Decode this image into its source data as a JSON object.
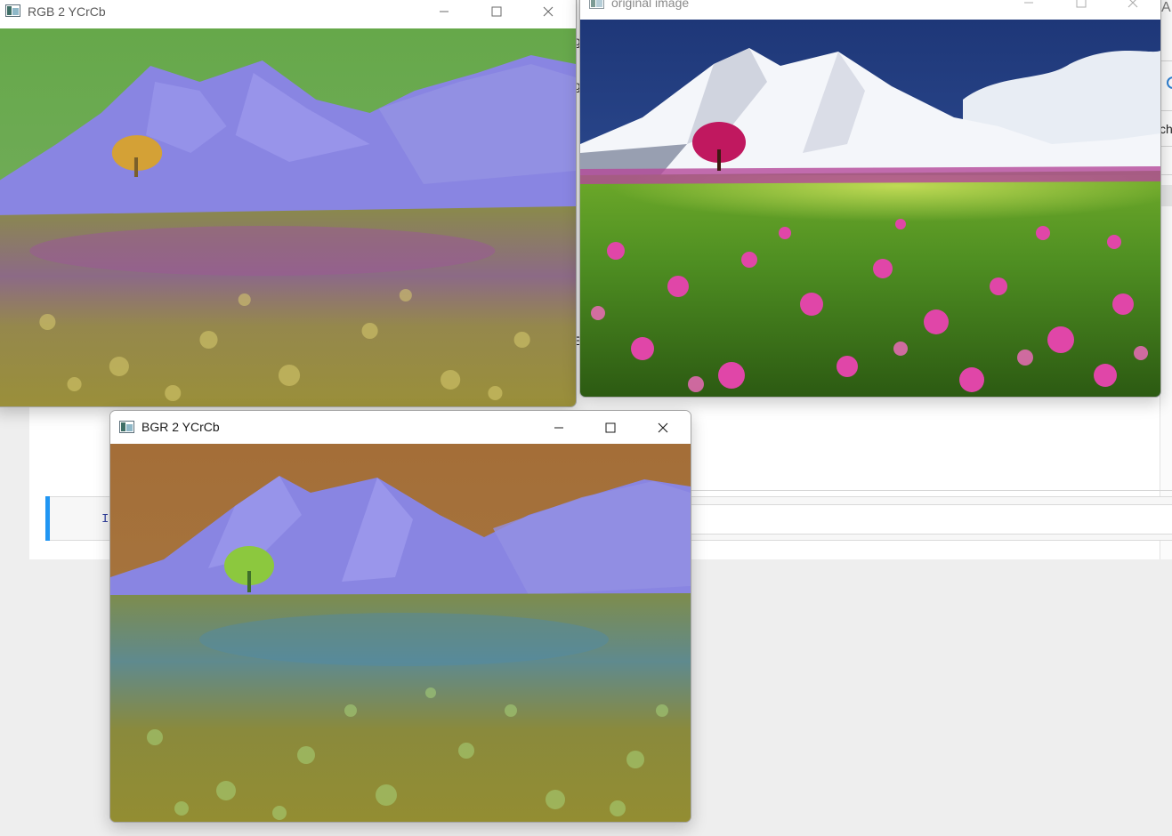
{
  "windows": [
    {
      "title": "RGB 2 YCrCb",
      "image_description_icon": "image-window-icon",
      "controls": [
        "minimize-icon",
        "maximize-icon",
        "close-icon"
      ]
    },
    {
      "title": "original image",
      "image_description_icon": "image-window-icon",
      "controls": [
        "minimize-icon",
        "maximize-icon",
        "close-icon"
      ]
    },
    {
      "title": "BGR 2 YCrCb",
      "image_description_icon": "image-window-icon",
      "controls": [
        "minimize-icon",
        "maximize-icon",
        "close-icon"
      ]
    }
  ],
  "background_app": {
    "fragments": [
      "g",
      "g",
      "cho",
      "E",
      "A"
    ],
    "cell_prompt": "I"
  },
  "colors": {
    "accent_blue": "#2196f3",
    "rgb2ycrcb_sky": "#6aa84a",
    "rgb2ycrcb_mountain": "#8a86e6",
    "bgr2ycrcb_sky": "#a8743a",
    "bgr2ycrcb_mountain": "#8a86e6",
    "original_sky": "#233f86",
    "original_field": "#3f8a1e",
    "original_flowers": "#d23a9a"
  }
}
